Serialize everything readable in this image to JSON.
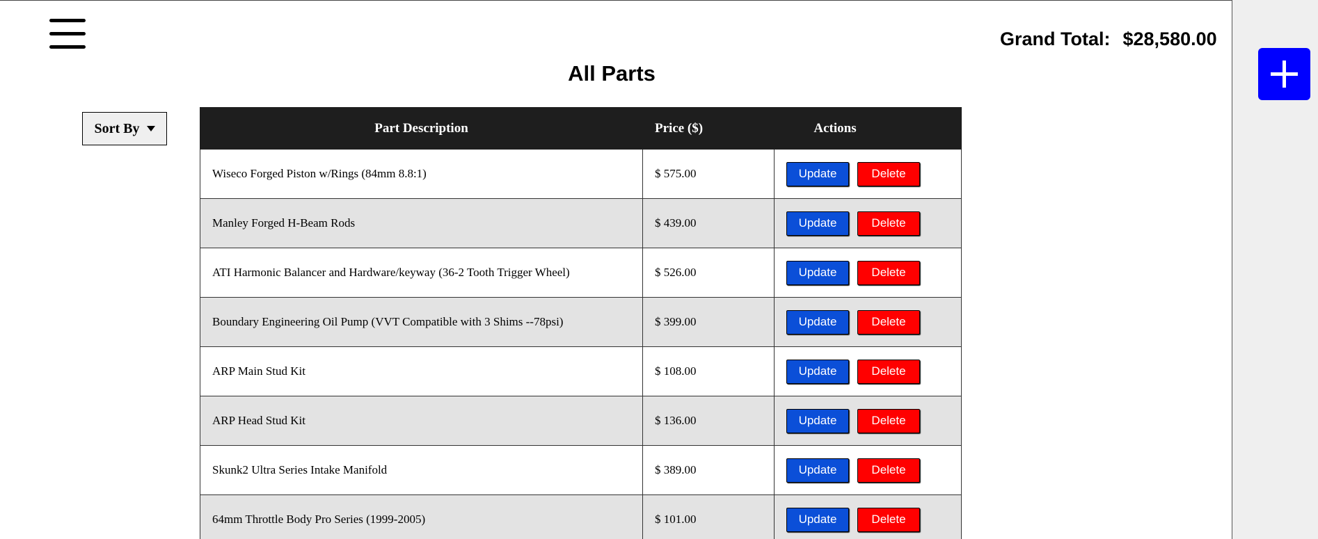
{
  "header": {
    "grand_total_label": "Grand Total:",
    "grand_total_value": "$28,580.00"
  },
  "page_title": "All Parts",
  "sort": {
    "label": "Sort By"
  },
  "table": {
    "columns": [
      "Part Description",
      "Price ($)",
      "Actions"
    ],
    "rows": [
      {
        "description": "Wiseco Forged Piston w/Rings (84mm 8.8:1)",
        "price": "$ 575.00"
      },
      {
        "description": "Manley Forged H-Beam Rods",
        "price": "$ 439.00"
      },
      {
        "description": "ATI Harmonic Balancer and Hardware/keyway (36-2 Tooth Trigger Wheel)",
        "price": "$ 526.00"
      },
      {
        "description": "Boundary Engineering Oil Pump (VVT Compatible with 3 Shims --78psi)",
        "price": "$ 399.00"
      },
      {
        "description": "ARP Main Stud Kit",
        "price": "$ 108.00"
      },
      {
        "description": "ARP Head Stud Kit",
        "price": "$ 136.00"
      },
      {
        "description": "Skunk2 Ultra Series Intake Manifold",
        "price": "$ 389.00"
      },
      {
        "description": "64mm Throttle Body Pro Series (1999-2005)",
        "price": "$ 101.00"
      }
    ],
    "update_label": "Update",
    "delete_label": "Delete"
  },
  "icons": {
    "menu": "hamburger-menu-icon",
    "add": "plus-icon",
    "sort": "caret-down-icon"
  },
  "colors": {
    "add_button": "#0000ff",
    "update_button": "#0b4fd8",
    "delete_button": "#ff0000",
    "table_header": "#1e1e1e",
    "alt_row": "#e3e3e3"
  }
}
